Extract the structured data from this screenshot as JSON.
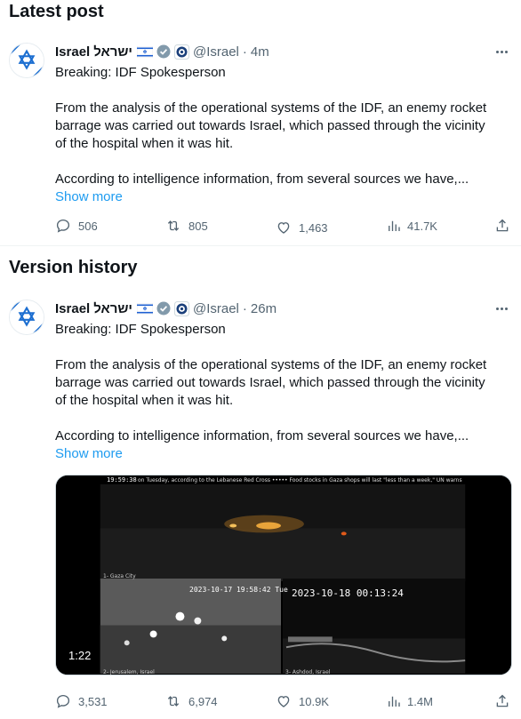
{
  "sections": {
    "latest_title": "Latest post",
    "history_title": "Version history"
  },
  "account": {
    "name": "Israel",
    "hebrew_name": "ישראל",
    "handle": "@Israel",
    "flag_icon": "israel-flag-icon",
    "verified_icon": "verified-badge-icon",
    "affiliation_icon": "government-seal-icon"
  },
  "latest": {
    "time": "4m",
    "line1": "Breaking: IDF Spokesperson",
    "para1_l1": "From the analysis of the operational systems of the IDF, an enemy rocket",
    "para1_l2": "barrage was carried out towards Israel, which passed through the vicinity",
    "para1_l3": "of the hospital when it was hit.",
    "para2_l1": "According to intelligence information, from several sources we have,...",
    "show_more": "Show more",
    "replies": "506",
    "reposts": "805",
    "likes": "1,463",
    "views": "41.7K"
  },
  "history": {
    "time": "26m",
    "line1": "Breaking: IDF Spokesperson",
    "para1_l1": "From the analysis of the operational systems of the IDF, an enemy rocket",
    "para1_l2": "barrage was carried out towards Israel, which passed through the vicinity",
    "para1_l3": "of the hospital when it was hit.",
    "para2_l1": "According to intelligence information, from several sources we have,...",
    "show_more": "Show more",
    "video": {
      "duration": "1:22",
      "top_clock": "19:59:38",
      "ticker": "on Tuesday, according to the Lebanese Red Cross ••••• Food stocks in Gaza shops will last \"less than a week,\" UN warns",
      "cam1_label": "1- Gaza City",
      "cam2_time": "2023-10-17 19:58:42 Tue",
      "cam2_label": "2- Jerusalem, Israel",
      "cam3_time": "2023-10-18 00:13:24",
      "cam3_label": "3- Ashdod, Israel"
    },
    "replies": "3,531",
    "reposts": "6,974",
    "likes": "10.9K",
    "views": "1.4M"
  },
  "colors": {
    "accent": "#1d9bf0",
    "muted": "#536471",
    "divider": "#eff3f4"
  }
}
